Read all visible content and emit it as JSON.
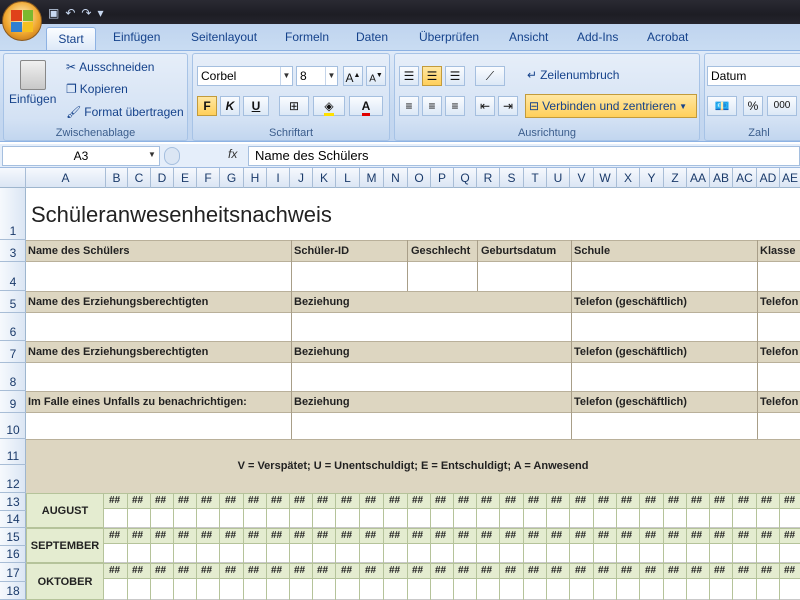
{
  "quick_access": {
    "save_icon": "save-icon",
    "undo_icon": "undo-icon",
    "redo_icon": "redo-icon"
  },
  "tabs": [
    "Start",
    "Einfügen",
    "Seitenlayout",
    "Formeln",
    "Daten",
    "Überprüfen",
    "Ansicht",
    "Add-Ins",
    "Acrobat"
  ],
  "ribbon": {
    "clipboard": {
      "paste": "Einfügen",
      "cut": "Ausschneiden",
      "copy": "Kopieren",
      "format_painter": "Format übertragen",
      "label": "Zwischenablage"
    },
    "font": {
      "name": "Corbel",
      "size": "8",
      "bold": "F",
      "italic": "K",
      "underline": "U",
      "label": "Schriftart"
    },
    "alignment": {
      "wrap": "Zeilenumbruch",
      "merge": "Verbinden und zentrieren",
      "label": "Ausrichtung"
    },
    "number": {
      "format": "Datum",
      "percent": "%",
      "thousands": "000",
      "label": "Zahl"
    }
  },
  "formula_bar": {
    "name_box": "A3",
    "fx": "fx",
    "content": "Name des Schülers"
  },
  "columns": [
    "A",
    "B",
    "C",
    "D",
    "E",
    "F",
    "G",
    "H",
    "I",
    "J",
    "K",
    "L",
    "M",
    "N",
    "O",
    "P",
    "Q",
    "R",
    "S",
    "T",
    "U",
    "V",
    "W",
    "X",
    "Y",
    "Z",
    "AA",
    "AB",
    "AC",
    "AD",
    "AE"
  ],
  "rows": [
    "1",
    "3",
    "4",
    "5",
    "6",
    "7",
    "8",
    "9",
    "10",
    "11",
    "12",
    "13",
    "14",
    "15",
    "16",
    "17",
    "18"
  ],
  "sheet": {
    "title": "Schüleranwesenheitsnachweis",
    "row3": [
      "Name des Schülers",
      "Schüler-ID",
      "Geschlecht",
      "Geburtsdatum",
      "Schule",
      "Klasse"
    ],
    "row5": [
      "Name des Erziehungsberechtigten",
      "Beziehung",
      "Telefon (geschäftlich)",
      "Telefon"
    ],
    "row7": [
      "Name des Erziehungsberechtigten",
      "Beziehung",
      "Telefon (geschäftlich)",
      "Telefon"
    ],
    "row9": [
      "Im Falle eines Unfalls zu benachrichtigen:",
      "Beziehung",
      "Telefon (geschäftlich)",
      "Telefon"
    ],
    "legend": "V = Verspätet; U = Unentschuldigt; E = Entschuldigt; A = Anwesend",
    "months": [
      "AUGUST",
      "SEPTEMBER",
      "OKTOBER"
    ],
    "hash": "##"
  },
  "colors": {
    "band": "#ddd6c1",
    "month": "#e4ecd0",
    "ribbon": "#c5d8f0",
    "highlight": "#ffcf5a"
  }
}
